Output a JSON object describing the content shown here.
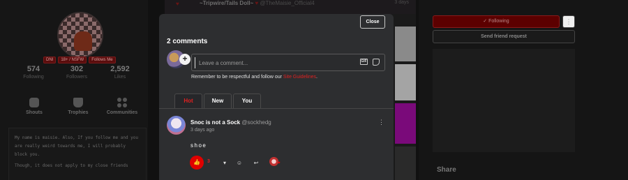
{
  "profile": {
    "tags": [
      "DNI",
      "18+ / NSFW",
      "Follows Me"
    ],
    "stats": [
      {
        "value": "574",
        "label": "Following"
      },
      {
        "value": "302",
        "label": "Followers"
      },
      {
        "value": "2,592",
        "label": "Likes"
      }
    ],
    "sections": [
      {
        "label": "Shouts",
        "icon": "speech-bubble-icon"
      },
      {
        "label": "Trophies",
        "icon": "trophy-icon"
      },
      {
        "label": "Communities",
        "icon": "communities-icon"
      }
    ],
    "bio": [
      "My name is maisie. Also, If you follow me and you are really weird towards me, I will probably block you.",
      "Though, it does not apply to my close friends"
    ]
  },
  "feed": {
    "post_title": "~Tripwire/Tails Doll~",
    "post_handle": "@TheMaisie_Official4",
    "post_time": "3 days"
  },
  "sidebar": {
    "following_label": "✓ Following",
    "more_label": "⋮",
    "friend_request_label": "Send friend request",
    "share_label": "Share"
  },
  "modal": {
    "close_label": "Close",
    "title": "2 comments",
    "add_label": "+",
    "comment_placeholder": "Leave a comment...",
    "gif_label": "GIF",
    "rules_prefix": "Remember to be respectful and follow our ",
    "rules_link": "Site Guidelines",
    "rules_suffix": ".",
    "tabs": [
      "Hot",
      "New",
      "You"
    ],
    "active_tab": "Hot",
    "accent_color": "#e00000"
  },
  "comments": [
    {
      "author": "Snoc is not a Sock",
      "handle": "@sockhedg",
      "time": "3 days ago",
      "body": "shoe",
      "likes": "3",
      "menu": "⋮"
    }
  ]
}
